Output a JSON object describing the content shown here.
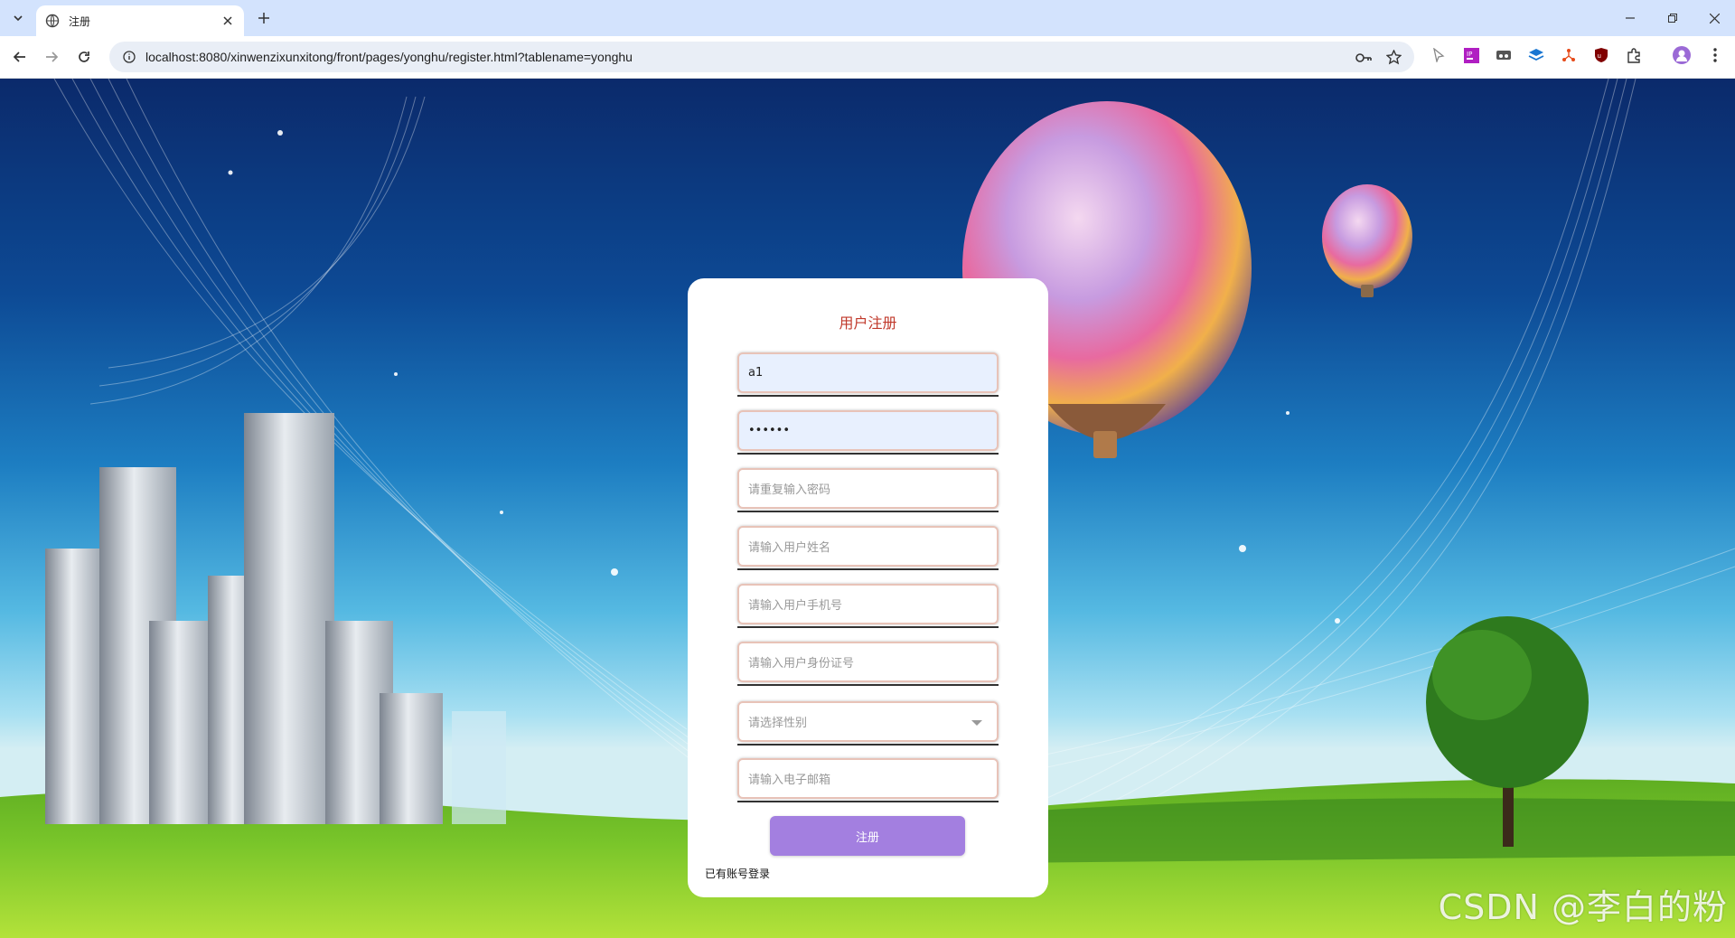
{
  "browser": {
    "tab_title": "注册",
    "url": "localhost:8080/xinwenzixunxitong/front/pages/yonghu/register.html?tablename=yonghu"
  },
  "form": {
    "title": "用户注册",
    "fields": [
      {
        "name": "username",
        "value": "a1",
        "placeholder": ""
      },
      {
        "name": "password",
        "value": "••••••",
        "placeholder": ""
      },
      {
        "name": "confirm-password",
        "value": "",
        "placeholder": "请重复输入密码"
      },
      {
        "name": "full-name",
        "value": "",
        "placeholder": "请输入用户姓名"
      },
      {
        "name": "phone",
        "value": "",
        "placeholder": "请输入用户手机号"
      },
      {
        "name": "id-number",
        "value": "",
        "placeholder": "请输入用户身份证号"
      },
      {
        "name": "gender",
        "value": "",
        "placeholder": "请选择性别"
      },
      {
        "name": "email",
        "value": "",
        "placeholder": "请输入电子邮箱"
      }
    ],
    "submit_label": "注册",
    "login_link": "已有账号登录"
  },
  "watermark": "CSDN @李白的粉",
  "colors": {
    "title": "#c0392b",
    "button": "#a37fe0",
    "chrome_tabbar": "#d3e3fd"
  }
}
